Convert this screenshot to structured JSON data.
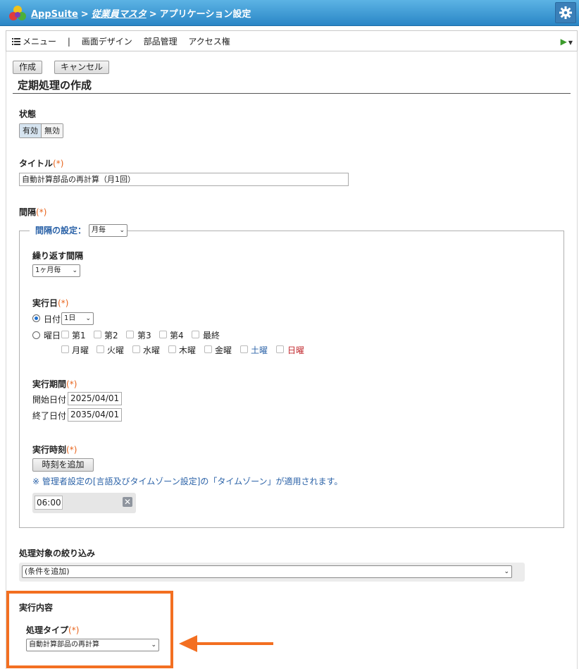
{
  "header": {
    "app_name": "AppSuite",
    "crumb_db": "従業員マスタ",
    "crumb_page": "アプリケーション設定",
    "separator": ">"
  },
  "menubar": {
    "menu_label": "メニュー",
    "divider": "|",
    "items": [
      "画面デザイン",
      "部品管理",
      "アクセス権"
    ]
  },
  "toolbar": {
    "create_label": "作成",
    "cancel_label": "キャンセル"
  },
  "page": {
    "title": "定期処理の作成"
  },
  "form": {
    "required_mark": "(*)",
    "status": {
      "label": "状態",
      "options": [
        "有効",
        "無効"
      ],
      "selected": "有効"
    },
    "title_field": {
      "label": "タイトル",
      "value": "自動計算部品の再計算（月1回）"
    },
    "interval": {
      "label": "間隔",
      "setting_label": "間隔の設定：",
      "setting_value": "月毎",
      "repeat_label": "繰り返す間隔",
      "repeat_value": "1ヶ月毎",
      "exec_day_label": "実行日",
      "date_option_label": "日付",
      "date_value": "1日",
      "weekday_option_label": "曜日",
      "weeks": [
        "第1",
        "第2",
        "第3",
        "第4",
        "最終"
      ],
      "days": [
        "月曜",
        "火曜",
        "水曜",
        "木曜",
        "金曜",
        "土曜",
        "日曜"
      ],
      "period_label": "実行期間",
      "start_label": "開始日付",
      "start_value": "2025/04/01",
      "end_label": "終了日付",
      "end_value": "2035/04/01",
      "time_label": "実行時刻",
      "add_time_label": "時刻を追加",
      "note": "※ 管理者設定の[言語及びタイムゾーン設定]の「タイムゾーン」が適用されます。",
      "time_value": "06:00"
    },
    "filter": {
      "label": "処理対象の絞り込み",
      "value": "(条件を追加)"
    },
    "execution": {
      "label": "実行内容",
      "type_label": "処理タイプ",
      "type_value": "自動計算部品の再計算"
    }
  },
  "colors": {
    "header_top": "#5cb3e4",
    "header_bottom": "#2a86c6",
    "required": "#e8641c",
    "legend": "#2c63a8",
    "saturday": "#2c63a8",
    "sunday": "#c0262b",
    "highlight": "#f36f21"
  },
  "icons": [
    "appsuite-logo-icon",
    "gear-icon",
    "menu-list-icon",
    "play-icon",
    "chevron-down-icon",
    "remove-icon",
    "arrow-left-icon"
  ]
}
